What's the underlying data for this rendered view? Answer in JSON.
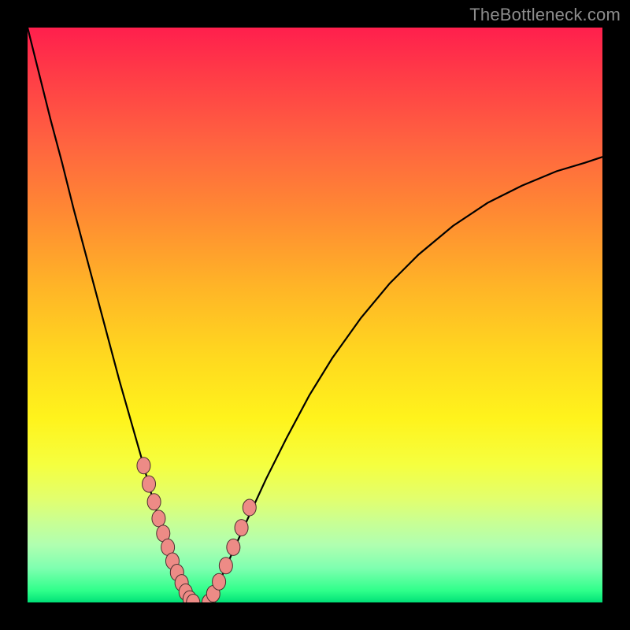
{
  "watermark": {
    "text": "TheBottleneck.com"
  },
  "chart_data": {
    "type": "line",
    "title": "",
    "xlabel": "",
    "ylabel": "",
    "xlim": [
      0,
      100
    ],
    "ylim": [
      0,
      100
    ],
    "series": [
      {
        "name": "left-branch",
        "x": [
          0.0,
          2.0,
          4.0,
          6.0,
          8.0,
          10.0,
          12.0,
          14.0,
          16.0,
          18.0,
          20.0,
          21.5,
          23.0,
          24.5,
          26.0,
          27.0,
          28.0,
          28.8
        ],
        "y": [
          100.0,
          92.0,
          84.0,
          76.5,
          68.5,
          61.0,
          53.5,
          46.0,
          38.5,
          31.5,
          24.5,
          19.0,
          14.0,
          9.5,
          5.5,
          3.0,
          1.0,
          0.0
        ]
      },
      {
        "name": "right-branch",
        "x": [
          31.5,
          32.5,
          34.0,
          36.0,
          38.5,
          41.5,
          45.0,
          49.0,
          53.0,
          58.0,
          63.0,
          68.0,
          74.0,
          80.0,
          86.0,
          92.0,
          97.0,
          100.0
        ],
        "y": [
          0.0,
          2.0,
          5.0,
          9.5,
          15.0,
          21.5,
          28.5,
          36.0,
          42.5,
          49.5,
          55.5,
          60.5,
          65.5,
          69.5,
          72.5,
          75.0,
          76.5,
          77.5
        ]
      },
      {
        "name": "points-left",
        "type": "scatter",
        "x": [
          20.2,
          21.1,
          22.0,
          22.8,
          23.6,
          24.4,
          25.2,
          26.0,
          26.8,
          27.5,
          28.2,
          28.8
        ],
        "y": [
          23.8,
          20.6,
          17.5,
          14.6,
          12.0,
          9.6,
          7.2,
          5.2,
          3.4,
          1.8,
          0.6,
          0.0
        ]
      },
      {
        "name": "points-right",
        "type": "scatter",
        "x": [
          31.5,
          32.3,
          33.3,
          34.5,
          35.8,
          37.2,
          38.6
        ],
        "y": [
          0.0,
          1.5,
          3.6,
          6.4,
          9.6,
          13.0,
          16.5
        ]
      }
    ],
    "colors": {
      "curve": "#000000",
      "point_fill": "#ed8b86",
      "point_stroke": "#4a2f2f"
    }
  }
}
